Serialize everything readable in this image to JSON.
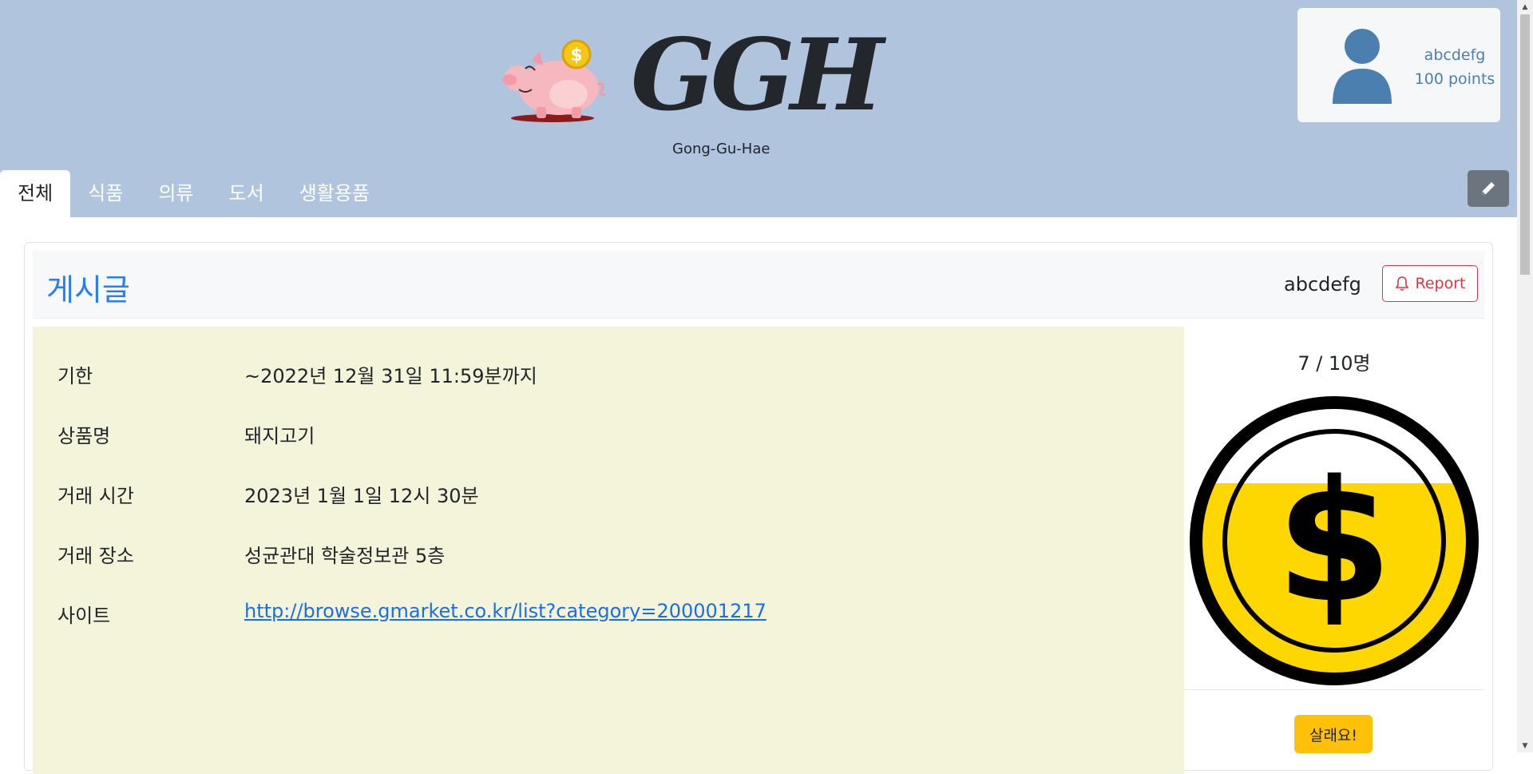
{
  "brand": {
    "title": "GGH",
    "subtitle": "Gong-Gu-Hae",
    "coin_symbol": "$"
  },
  "user": {
    "name": "abcdefg",
    "points": "100 points"
  },
  "tabs": [
    {
      "label": "전체",
      "active": true
    },
    {
      "label": "식품",
      "active": false
    },
    {
      "label": "의류",
      "active": false
    },
    {
      "label": "도서",
      "active": false
    },
    {
      "label": "생활용품",
      "active": false
    }
  ],
  "post": {
    "heading": "게시글",
    "author": "abcdefg",
    "report_label": "Report",
    "fields": [
      {
        "label": "기한",
        "value": "~2022년 12월 31일 11:59분까지"
      },
      {
        "label": "상품명",
        "value": "돼지고기"
      },
      {
        "label": "거래 시간",
        "value": "2023년 1월 1일 12시 30분"
      },
      {
        "label": "거래 장소",
        "value": "성균관대 학술정보관 5층"
      },
      {
        "label": "사이트",
        "value": "http://browse.gmarket.co.kr/list?category=200001217"
      }
    ],
    "participants": "7 / 10명",
    "progress_fraction": 0.7,
    "buy_label": "살래요!"
  },
  "colors": {
    "header_bg": "#b0c4de",
    "accent_blue": "#2a7ff0",
    "report_red": "#dc3545",
    "buy_yellow": "#ffc107",
    "coin_yellow": "#ffd700",
    "info_bg": "#f3f4da"
  },
  "icons": {
    "pig": "piggy-bank-icon",
    "avatar": "user-avatar-icon",
    "edit": "pencil-icon",
    "report": "bell-icon",
    "coin": "dollar-coin-icon"
  }
}
